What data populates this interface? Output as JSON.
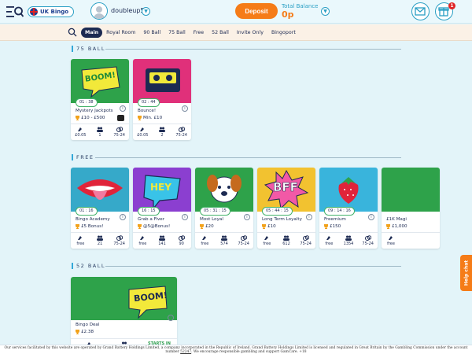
{
  "header": {
    "brand": "UK Bingo",
    "username": "doubleup5",
    "deposit_label": "Deposit",
    "balance_label": "Total Balance",
    "balance_value": "0p",
    "gift_badge": "1"
  },
  "nav": {
    "tabs": [
      {
        "label": "Main",
        "active": true
      },
      {
        "label": "Royal Room"
      },
      {
        "label": "90 Ball"
      },
      {
        "label": "75 Ball"
      },
      {
        "label": "Free"
      },
      {
        "label": "52 Ball"
      },
      {
        "label": "Invite Only"
      },
      {
        "label": "Bingoport"
      }
    ]
  },
  "sections": {
    "ball75": {
      "title": "75 BALL",
      "cards": [
        {
          "name": "Mystery Jackpots",
          "timer": "01 : 38",
          "prize": "£10 - £500",
          "stats": [
            "£0.05",
            "1",
            "75-24"
          ],
          "art_text": "BOOM!",
          "bg": "#2ea24a"
        },
        {
          "name": "Bounce!",
          "timer": "02 : 44",
          "prize": "Min. £10",
          "stats": [
            "£0.05",
            "2",
            "75-24"
          ],
          "art_text": "",
          "bg": "#e0307a"
        }
      ]
    },
    "free": {
      "title": "FREE",
      "cards": [
        {
          "name": "Bingo Academy",
          "timer": "01 : 16",
          "prize": "£5 Bonus!",
          "stats": [
            "free",
            "21",
            "75-24"
          ],
          "bg": "#36a9c9"
        },
        {
          "name": "Grab a Fiver",
          "timer": "16 : 15",
          "prize": "@5@Bonus!",
          "stats": [
            "free",
            "141",
            "90"
          ],
          "art_text": "HEY",
          "bg": "#8b3fd0"
        },
        {
          "name": "Most Loyal",
          "timer": "05 : 31 : 15",
          "prize": "£20",
          "stats": [
            "free",
            "574",
            "75-24"
          ],
          "bg": "#2ea24a"
        },
        {
          "name": "Long Term Loyalty",
          "timer": "05 : 44 : 15",
          "prize": "£10",
          "stats": [
            "free",
            "612",
            "75-24"
          ],
          "art_text": "BFF",
          "bg": "#f2c230"
        },
        {
          "name": "Freemium",
          "timer": "09 : 14 : 16",
          "prize": "£150",
          "stats": [
            "free",
            "1354",
            "75-24"
          ],
          "bg": "#39b4dc"
        },
        {
          "name": "£1K Magi",
          "timer": "",
          "prize": "£1,000",
          "stats": [
            "free",
            "",
            ""
          ],
          "bg": "#2ea24a"
        }
      ]
    },
    "ball52": {
      "title": "52 BALL",
      "cards": [
        {
          "name": "Bingo Deal",
          "prize": "£2.38",
          "starts_in": "STARTS IN",
          "art_text": "BOOM!",
          "bg": "#2ea24a"
        }
      ]
    }
  },
  "help_chat_label": "Help chat",
  "footer": {
    "text": "Our services facilitated by this website are operated by Grand Battery Holdings Limited, a company incorporated in the Republic of Ireland. Grand Battery Holdings Limited is licensed and regulated in Great Britain by the Gambling Commission under the account number",
    "account_number": "52247",
    "text_after": ". We encourage responsible gambling and support GamCare. +18"
  },
  "colors": {
    "accent_orange": "#f57c18",
    "accent_blue": "#2a9fc4",
    "navy": "#1c2a52",
    "timer_green": "#45b36b"
  }
}
